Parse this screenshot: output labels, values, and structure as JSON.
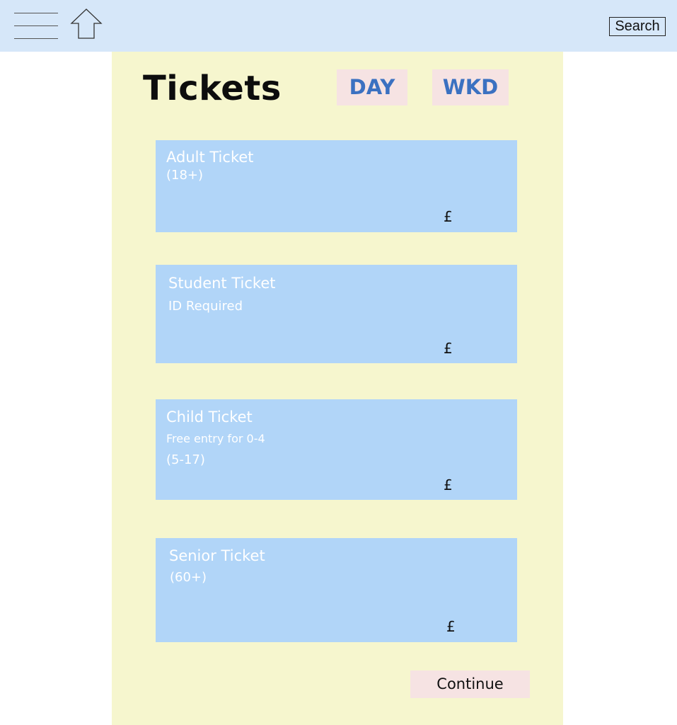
{
  "header": {
    "menu_icon": "hamburger-menu-icon",
    "home_icon": "home-arrow-icon",
    "search_label": "Search"
  },
  "page": {
    "title": "Tickets",
    "toggles": [
      {
        "label": "DAY"
      },
      {
        "label": "WKD"
      }
    ]
  },
  "tickets": [
    {
      "name": "Adult Ticket",
      "sub": "(18+)",
      "price": "£"
    },
    {
      "name": "Student Ticket",
      "note": "ID Required",
      "price": "£"
    },
    {
      "name": "Child Ticket",
      "note": "Free entry for 0-4",
      "sub": "(5-17)",
      "price": "£"
    },
    {
      "name": "Senior Ticket",
      "sub": "(60+)",
      "price": "£"
    }
  ],
  "footer": {
    "continue_label": "Continue"
  },
  "colors": {
    "topbar": "#d6e7f9",
    "panel": "#f6f6ce",
    "card": "#b1d5f8",
    "toggle_bg": "#f6e3e3",
    "toggle_text": "#3b71c1"
  }
}
